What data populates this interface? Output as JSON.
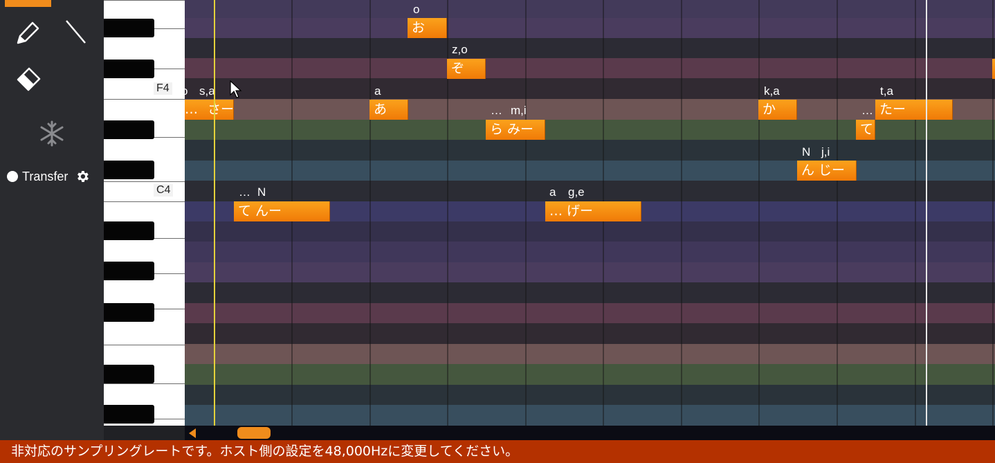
{
  "toolbar": {
    "tools": [
      "pencil-icon",
      "line-icon",
      "eraser-icon",
      "freeze-icon"
    ],
    "transfer_label": "Transfer"
  },
  "keyboard": {
    "labels": {
      "f4": "F4",
      "c4": "C4"
    }
  },
  "notes": [
    {
      "lyric": "お",
      "phoneme": "o"
    },
    {
      "lyric": "ぞ",
      "phoneme": "z,o"
    },
    {
      "lyric": "さー",
      "lead": "…",
      "phoneme": "s,a",
      "pre": "o"
    },
    {
      "lyric": "あ",
      "phoneme": "a"
    },
    {
      "lyric": "か",
      "phoneme": "k,a"
    },
    {
      "lyric": "たー",
      "phoneme": "t,a",
      "pre": "…"
    },
    {
      "lyric": "ら みー",
      "phoneme": "m,i",
      "pre": "…"
    },
    {
      "lyric": "て",
      "phoneme": ""
    },
    {
      "lyric": "ん じー",
      "phoneme": "j,i",
      "pre": "N"
    },
    {
      "lyric": "て んー",
      "phoneme": "N",
      "pre": "…"
    },
    {
      "lyric": "… げー",
      "phoneme": "g,e",
      "pre": "a"
    }
  ],
  "scrollbar": {
    "position": 0.1
  },
  "status": {
    "message": "非対応のサンプリングレートです。ホスト側の設定を48,000Hzに変更してください。",
    "color": "#b43100"
  },
  "colors": {
    "accent": "#f08c1c",
    "playhead": "#e5d23a"
  }
}
